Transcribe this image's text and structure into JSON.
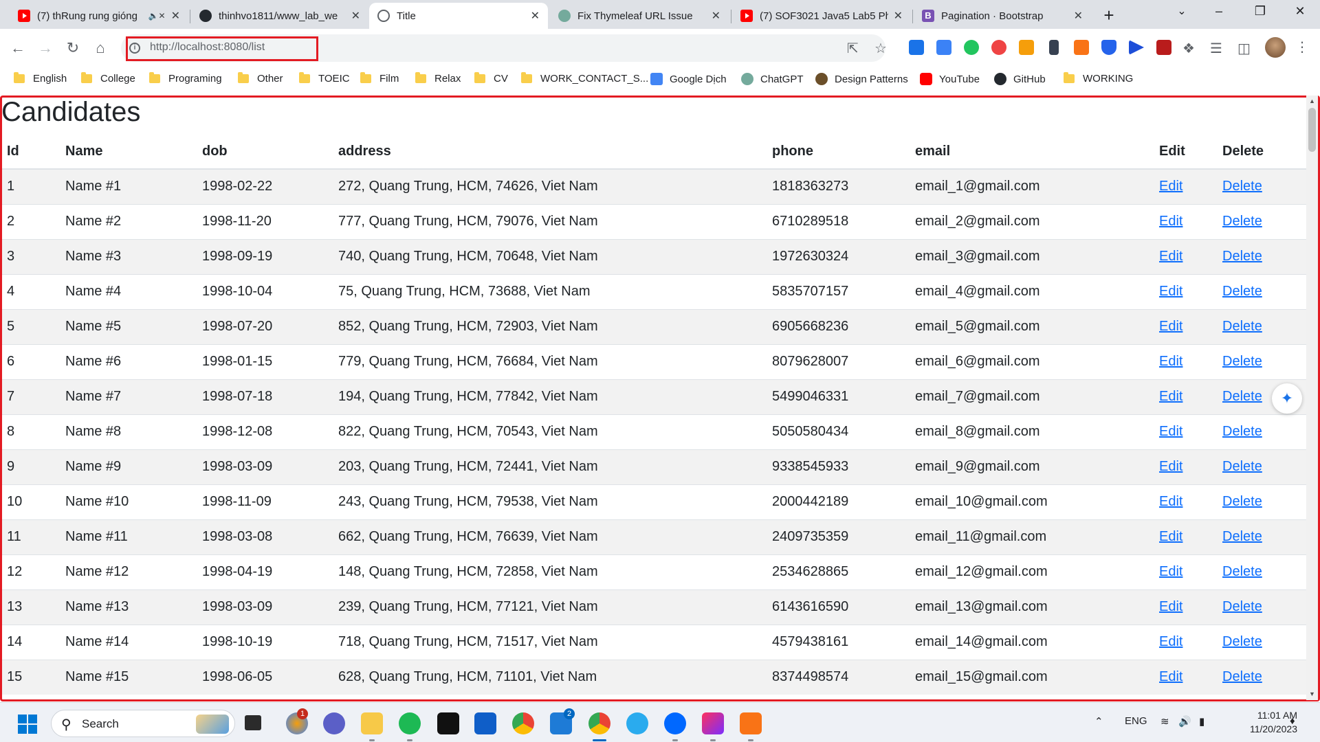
{
  "browser": {
    "tabs": [
      {
        "title": "(7) thRung rung gióng",
        "favicon": "youtube-icon",
        "muted": true
      },
      {
        "title": "thinhvo1811/www_lab_we",
        "favicon": "github-icon"
      },
      {
        "title": "Title",
        "favicon": "globe-icon",
        "active": true
      },
      {
        "title": "Fix Thymeleaf URL Issue",
        "favicon": "chatgpt-icon"
      },
      {
        "title": "(7) SOF3021 Java5 Lab5 Ph",
        "favicon": "youtube-icon"
      },
      {
        "title": "Pagination · Bootstrap",
        "favicon": "bootstrap-icon"
      }
    ],
    "url": "http://localhost:8080/list",
    "bookmarks": [
      {
        "label": "English",
        "icon": "folder-icon"
      },
      {
        "label": "College",
        "icon": "folder-icon"
      },
      {
        "label": "Programing",
        "icon": "folder-icon"
      },
      {
        "label": "Other",
        "icon": "folder-icon"
      },
      {
        "label": "TOEIC",
        "icon": "folder-icon"
      },
      {
        "label": "Film",
        "icon": "folder-icon"
      },
      {
        "label": "Relax",
        "icon": "folder-icon"
      },
      {
        "label": "CV",
        "icon": "folder-icon"
      },
      {
        "label": "WORK_CONTACT_S...",
        "icon": "folder-icon"
      },
      {
        "label": "Google Dịch",
        "icon": "google-translate-icon"
      },
      {
        "label": "ChatGPT",
        "icon": "chatgpt-icon"
      },
      {
        "label": "Design Patterns",
        "icon": "refactoring-guru-icon"
      },
      {
        "label": "YouTube",
        "icon": "youtube-icon"
      },
      {
        "label": "GitHub",
        "icon": "github-icon"
      },
      {
        "label": "WORKING",
        "icon": "folder-icon"
      }
    ],
    "highlight_color": "#e31b23"
  },
  "page": {
    "title": "Candidates",
    "columns": [
      "Id",
      "Name",
      "dob",
      "address",
      "phone",
      "email",
      "Edit",
      "Delete"
    ],
    "rows": [
      {
        "id": "1",
        "name": "Name #1",
        "dob": "1998-02-22",
        "address": "272, Quang Trung, HCM, 74626, Viet Nam",
        "phone": "1818363273",
        "email": "email_1@gmail.com",
        "edit": "Edit",
        "delete": "Delete"
      },
      {
        "id": "2",
        "name": "Name #2",
        "dob": "1998-11-20",
        "address": "777, Quang Trung, HCM, 79076, Viet Nam",
        "phone": "6710289518",
        "email": "email_2@gmail.com",
        "edit": "Edit",
        "delete": "Delete"
      },
      {
        "id": "3",
        "name": "Name #3",
        "dob": "1998-09-19",
        "address": "740, Quang Trung, HCM, 70648, Viet Nam",
        "phone": "1972630324",
        "email": "email_3@gmail.com",
        "edit": "Edit",
        "delete": "Delete"
      },
      {
        "id": "4",
        "name": "Name #4",
        "dob": "1998-10-04",
        "address": "75, Quang Trung, HCM, 73688, Viet Nam",
        "phone": "5835707157",
        "email": "email_4@gmail.com",
        "edit": "Edit",
        "delete": "Delete"
      },
      {
        "id": "5",
        "name": "Name #5",
        "dob": "1998-07-20",
        "address": "852, Quang Trung, HCM, 72903, Viet Nam",
        "phone": "6905668236",
        "email": "email_5@gmail.com",
        "edit": "Edit",
        "delete": "Delete"
      },
      {
        "id": "6",
        "name": "Name #6",
        "dob": "1998-01-15",
        "address": "779, Quang Trung, HCM, 76684, Viet Nam",
        "phone": "8079628007",
        "email": "email_6@gmail.com",
        "edit": "Edit",
        "delete": "Delete"
      },
      {
        "id": "7",
        "name": "Name #7",
        "dob": "1998-07-18",
        "address": "194, Quang Trung, HCM, 77842, Viet Nam",
        "phone": "5499046331",
        "email": "email_7@gmail.com",
        "edit": "Edit",
        "delete": "Delete"
      },
      {
        "id": "8",
        "name": "Name #8",
        "dob": "1998-12-08",
        "address": "822, Quang Trung, HCM, 70543, Viet Nam",
        "phone": "5050580434",
        "email": "email_8@gmail.com",
        "edit": "Edit",
        "delete": "Delete"
      },
      {
        "id": "9",
        "name": "Name #9",
        "dob": "1998-03-09",
        "address": "203, Quang Trung, HCM, 72441, Viet Nam",
        "phone": "9338545933",
        "email": "email_9@gmail.com",
        "edit": "Edit",
        "delete": "Delete"
      },
      {
        "id": "10",
        "name": "Name #10",
        "dob": "1998-11-09",
        "address": "243, Quang Trung, HCM, 79538, Viet Nam",
        "phone": "2000442189",
        "email": "email_10@gmail.com",
        "edit": "Edit",
        "delete": "Delete"
      },
      {
        "id": "11",
        "name": "Name #11",
        "dob": "1998-03-08",
        "address": "662, Quang Trung, HCM, 76639, Viet Nam",
        "phone": "2409735359",
        "email": "email_11@gmail.com",
        "edit": "Edit",
        "delete": "Delete"
      },
      {
        "id": "12",
        "name": "Name #12",
        "dob": "1998-04-19",
        "address": "148, Quang Trung, HCM, 72858, Viet Nam",
        "phone": "2534628865",
        "email": "email_12@gmail.com",
        "edit": "Edit",
        "delete": "Delete"
      },
      {
        "id": "13",
        "name": "Name #13",
        "dob": "1998-03-09",
        "address": "239, Quang Trung, HCM, 77121, Viet Nam",
        "phone": "6143616590",
        "email": "email_13@gmail.com",
        "edit": "Edit",
        "delete": "Delete"
      },
      {
        "id": "14",
        "name": "Name #14",
        "dob": "1998-10-19",
        "address": "718, Quang Trung, HCM, 71517, Viet Nam",
        "phone": "4579438161",
        "email": "email_14@gmail.com",
        "edit": "Edit",
        "delete": "Delete"
      },
      {
        "id": "15",
        "name": "Name #15",
        "dob": "1998-06-05",
        "address": "628, Quang Trung, HCM, 71101, Viet Nam",
        "phone": "8374498574",
        "email": "email_15@gmail.com",
        "edit": "Edit",
        "delete": "Delete"
      }
    ],
    "link_color": "#0d6efd"
  },
  "taskbar": {
    "search_label": "Search",
    "apps": [
      {
        "name": "widgets-icon"
      },
      {
        "name": "task-view-icon"
      },
      {
        "name": "weather-app-icon",
        "badge": "1"
      },
      {
        "name": "teams-chat-icon"
      },
      {
        "name": "file-explorer-icon"
      },
      {
        "name": "spotify-icon"
      },
      {
        "name": "notion-icon"
      },
      {
        "name": "microsoft-store-icon"
      },
      {
        "name": "chrome-icon"
      },
      {
        "name": "mail-icon",
        "badge": "2"
      },
      {
        "name": "chrome-active-icon"
      },
      {
        "name": "telegram-icon"
      },
      {
        "name": "zalo-icon"
      },
      {
        "name": "intellij-icon"
      },
      {
        "name": "pdf-app-icon"
      }
    ],
    "language": "ENG",
    "time": "11:01 AM",
    "date": "11/20/2023"
  }
}
